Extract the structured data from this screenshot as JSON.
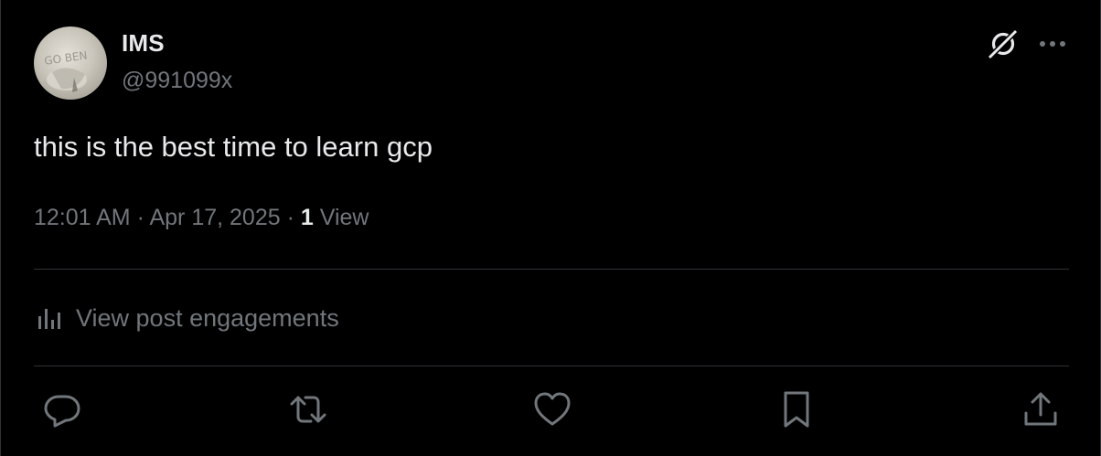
{
  "post": {
    "author_name": "IMS",
    "author_handle": "@991099x",
    "text": "this is the best time to learn gcp",
    "timestamp": "12:01 AM · Apr 17, 2025",
    "separator": " · ",
    "views_count": "1",
    "views_label": "View"
  },
  "engagements": {
    "label": "View post engagements",
    "icon": "analytics-icon"
  },
  "actions": {
    "reply": "reply-icon",
    "repost": "repost-icon",
    "like": "like-icon",
    "bookmark": "bookmark-icon",
    "share": "share-icon"
  },
  "header_icons": {
    "grok": "grok-icon",
    "more": "more-icon"
  },
  "avatar_text": "GO BEN",
  "colors": {
    "background": "#000000",
    "primary_text": "#e7e9ea",
    "secondary_text": "#71767b",
    "divider": "#2f3336"
  }
}
